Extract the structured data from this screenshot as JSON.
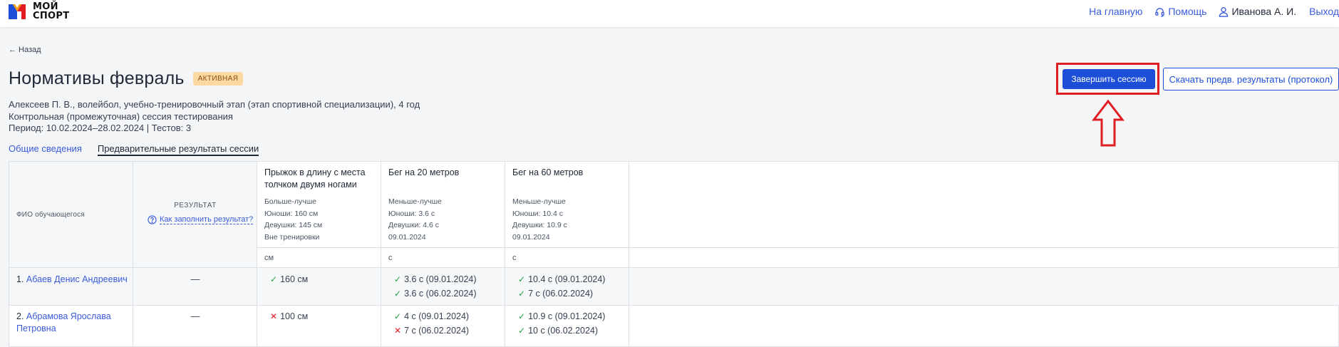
{
  "header": {
    "logo_line1": "МОЙ",
    "logo_line2": "СПОРТ",
    "nav_home": "На главную",
    "nav_help": "Помощь",
    "user_name": "Иванова А. И.",
    "nav_exit": "Выход"
  },
  "back_label": "← Назад",
  "page": {
    "title": "Нормативы февраль",
    "status_badge": "АКТИВНАЯ",
    "info_line1": "Алексеев П. В., волейбол, учебно-тренировочный этап (этап спортивной специализации), 4 год",
    "info_line2": "Контрольная (промежуточная) сессия тестирования",
    "info_line3": "Период: 10.02.2024–28.02.2024 | Тестов: 3"
  },
  "tabs": {
    "general": "Общие сведения",
    "preliminary": "Предварительные результаты сессии"
  },
  "actions": {
    "finish_session": "Завершить сессию",
    "download_protocol": "Скачать предв. результаты (протокол)"
  },
  "table": {
    "col_fio": "ФИО обучающегося",
    "col_result": "РЕЗУЛЬТАТ",
    "help_link": "Как заполнить результат?",
    "tests": [
      {
        "name_line1": "Прыжок в длину с места",
        "name_line2": "толчком двумя ногами",
        "desc": [
          "Больше-лучше",
          "Юноши: 160 см",
          "Девушки: 145 см",
          "Вне тренировки"
        ],
        "unit": "см"
      },
      {
        "name_line1": "Бег на 20 метров",
        "name_line2": "",
        "desc": [
          "Меньше-лучше",
          "Юноши: 3.6 с",
          "Девушки: 4.6 с",
          "09.01.2024"
        ],
        "unit": "с"
      },
      {
        "name_line1": "Бег на 60 метров",
        "name_line2": "",
        "desc": [
          "Меньше-лучше",
          "Юноши: 10.4 с",
          "Девушки: 10.9 с",
          "09.01.2024"
        ],
        "unit": "с"
      }
    ],
    "rows": [
      {
        "num": "1.",
        "name_line1": "Абаев Денис Андреевич",
        "name_line2": "",
        "result": "—",
        "t1": [
          {
            "status": "ok",
            "text": "160 см"
          }
        ],
        "t2": [
          {
            "status": "ok",
            "text": "3.6 с (09.01.2024)"
          },
          {
            "status": "ok",
            "text": "3.6 с (06.02.2024)"
          }
        ],
        "t3": [
          {
            "status": "ok",
            "text": "10.4 с (09.01.2024)"
          },
          {
            "status": "ok",
            "text": "7 с (06.02.2024)"
          }
        ]
      },
      {
        "num": "2.",
        "name_line1": "Абрамова Ярослава",
        "name_line2": "Петровна",
        "result": "—",
        "t1": [
          {
            "status": "bad",
            "text": "100 см"
          }
        ],
        "t2": [
          {
            "status": "ok",
            "text": "4 с (09.01.2024)"
          },
          {
            "status": "bad",
            "text": "7 с (06.02.2024)"
          }
        ],
        "t3": [
          {
            "status": "ok",
            "text": "10.9 с (09.01.2024)"
          },
          {
            "status": "ok",
            "text": "10 с (06.02.2024)"
          }
        ]
      }
    ]
  },
  "colors": {
    "accent": "#1d4ed8",
    "link": "#3b5bdb",
    "badge_bg": "#fcd9a3",
    "highlight": "#e11d24",
    "ok": "#22a045",
    "bad": "#e11d24"
  }
}
